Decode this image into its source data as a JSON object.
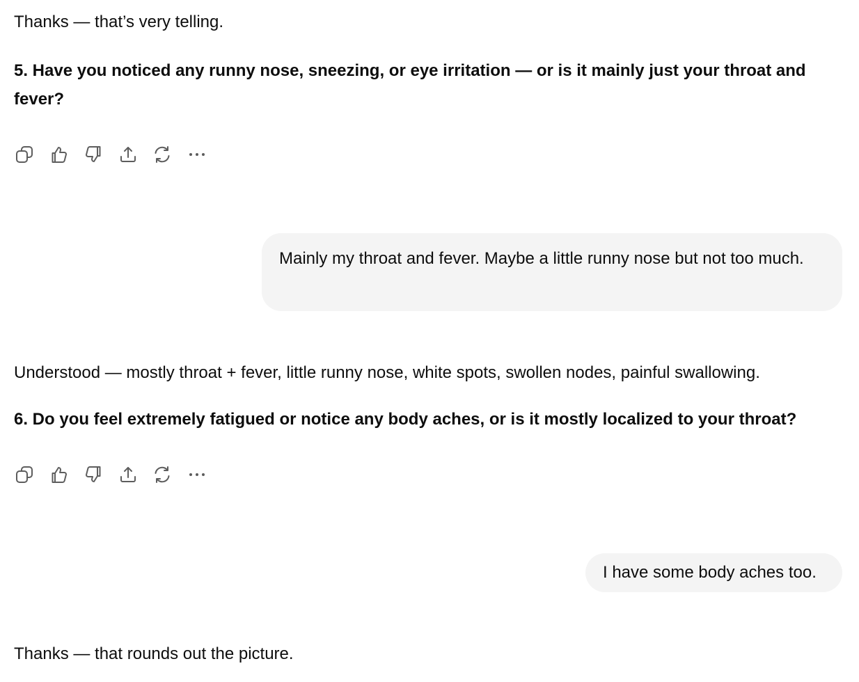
{
  "messages": {
    "assistant_1_tail": "Thanks — that’s very telling.",
    "assistant_1_question": "5. Have you noticed any runny nose, sneezing, or eye irritation — or is it mainly just your throat and fever?",
    "user_1": "Mainly my throat and fever. Maybe a little runny nose but not too much.",
    "assistant_2_summary": "Understood — mostly throat + fever, little runny nose, white spots, swollen nodes, painful swallowing.",
    "assistant_2_question": "6. Do you feel extremely fatigued or notice any body aches, or is it mostly localized to your throat?",
    "user_2": "I have some body aches too.",
    "assistant_3_start": "Thanks — that rounds out the picture."
  },
  "toolbar_icons": [
    "copy-icon",
    "thumbs-up-icon",
    "thumbs-down-icon",
    "share-icon",
    "regenerate-icon",
    "more-icon"
  ],
  "colors": {
    "background": "#ffffff",
    "text": "#0d0d0d",
    "user_bubble": "#f4f4f4",
    "icon": "#5d5d5d"
  }
}
